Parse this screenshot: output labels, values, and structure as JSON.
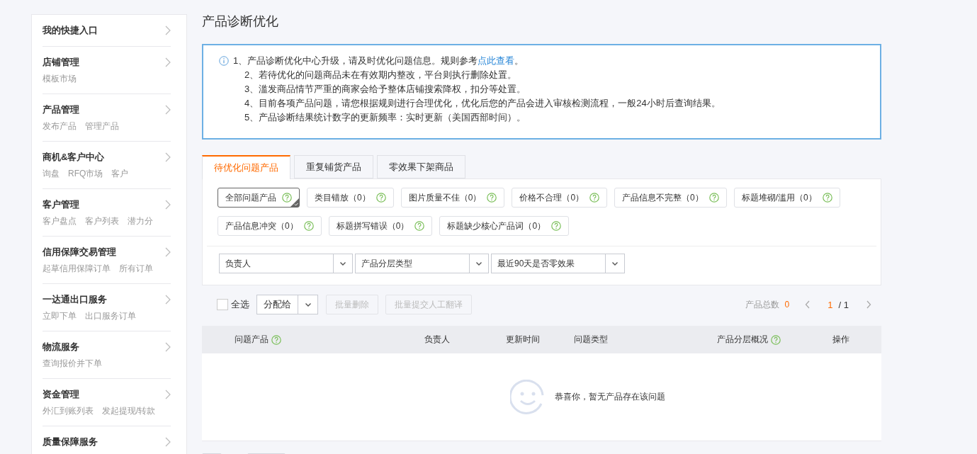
{
  "sidebar": {
    "sections": [
      {
        "title": "我的快捷入口"
      },
      {
        "title": "店铺管理",
        "links": [
          "模板市场"
        ]
      },
      {
        "title": "产品管理",
        "links": [
          "发布产品",
          "管理产品"
        ]
      },
      {
        "title": "商机&客户中心",
        "links": [
          "询盘",
          "RFQ市场",
          "客户"
        ]
      },
      {
        "title": "客户管理",
        "links": [
          "客户盘点",
          "客户列表",
          "潜力分"
        ]
      },
      {
        "title": "信用保障交易管理",
        "links": [
          "起草信用保障订单",
          "所有订单"
        ]
      },
      {
        "title": "一达通出口服务",
        "links": [
          "立即下单",
          "出口服务订单"
        ]
      },
      {
        "title": "物流服务",
        "links": [
          "查询报价并下单"
        ]
      },
      {
        "title": "资金管理",
        "links": [
          "外汇到账列表",
          "发起提现/转款"
        ]
      },
      {
        "title": "质量保障服务"
      }
    ]
  },
  "page_title": "产品诊断优化",
  "notice": {
    "lines": [
      {
        "text": "1、产品诊断优化中心升级，请及时优化问题信息。规则参考",
        "link": "点此查看",
        "after": "。"
      },
      {
        "text": "2、若待优化的问题商品未在有效期内整改，平台则执行删除处置。"
      },
      {
        "text": "3、滥发商品情节严重的商家会给予整体店铺搜索降权，扣分等处置。"
      },
      {
        "text": "4、目前各项产品问题，请您根据规则进行合理优化，优化后您的产品会进入审核检测流程，一般24小时后查询结果。"
      },
      {
        "text": "5、产品诊断结果统计数字的更新频率：实时更新（美国西部时间）。"
      }
    ]
  },
  "tabs": [
    {
      "label": "待优化问题产品",
      "selected": true
    },
    {
      "label": "重复铺货产品",
      "selected": false
    },
    {
      "label": "零效果下架商品",
      "selected": false
    }
  ],
  "filter_chips": [
    {
      "label": "全部问题产品",
      "selected": true
    },
    {
      "label": "类目错放（0）",
      "selected": false
    },
    {
      "label": "图片质量不佳（0）",
      "selected": false
    },
    {
      "label": "价格不合理（0）",
      "selected": false
    },
    {
      "label": "产品信息不完整（0）",
      "selected": false
    },
    {
      "label": "标题堆砌/滥用（0）",
      "selected": false
    },
    {
      "label": "产品信息冲突（0）",
      "selected": false
    },
    {
      "label": "标题拼写错误（0）",
      "selected": false
    },
    {
      "label": "标题缺少核心产品词（0）",
      "selected": false
    }
  ],
  "selects": [
    {
      "placeholder": "负责人"
    },
    {
      "placeholder": "产品分层类型"
    },
    {
      "placeholder": "最近90天是否零效果"
    }
  ],
  "toolbar": {
    "select_all": {
      "label": "全选",
      "checked": false
    },
    "assign": "分配给",
    "buttons": [
      {
        "label": "批量删除",
        "disabled": true
      },
      {
        "label": "批量提交人工翻译",
        "disabled": true
      }
    ],
    "total_label": "产品总数",
    "total": "0",
    "page": "1",
    "pages": "/ 1"
  },
  "table": {
    "columns": [
      {
        "label": "问题产品",
        "help": true
      },
      {
        "label": "负责人",
        "help": false
      },
      {
        "label": "更新时间",
        "help": false
      },
      {
        "label": "问题类型",
        "help": false
      },
      {
        "label": "产品分层概况",
        "help": true
      },
      {
        "label": "操作",
        "help": false
      }
    ],
    "empty_message": "恭喜你，暂无产品存在该问题"
  }
}
